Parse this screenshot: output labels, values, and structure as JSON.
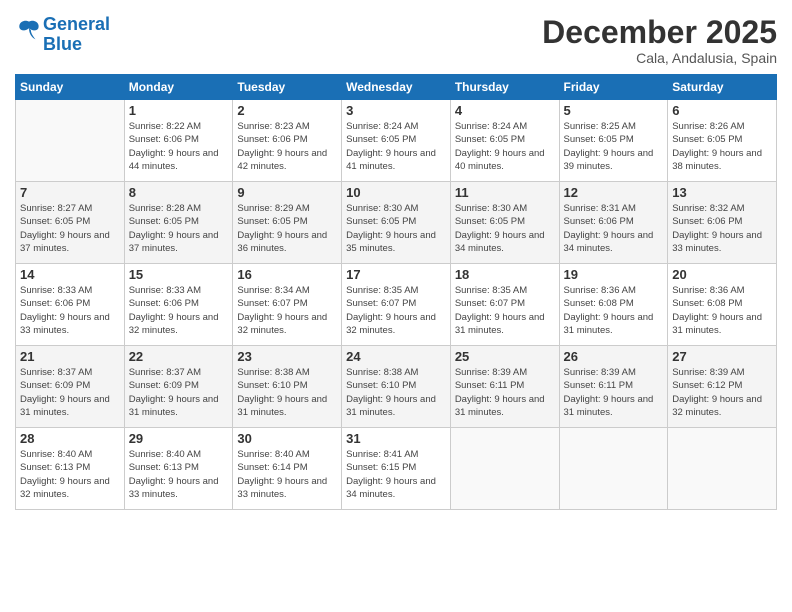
{
  "header": {
    "logo_line1": "General",
    "logo_line2": "Blue",
    "month": "December 2025",
    "location": "Cala, Andalusia, Spain"
  },
  "weekdays": [
    "Sunday",
    "Monday",
    "Tuesday",
    "Wednesday",
    "Thursday",
    "Friday",
    "Saturday"
  ],
  "weeks": [
    [
      {
        "day": "",
        "sunrise": "",
        "sunset": "",
        "daylight": ""
      },
      {
        "day": "1",
        "sunrise": "Sunrise: 8:22 AM",
        "sunset": "Sunset: 6:06 PM",
        "daylight": "Daylight: 9 hours and 44 minutes."
      },
      {
        "day": "2",
        "sunrise": "Sunrise: 8:23 AM",
        "sunset": "Sunset: 6:06 PM",
        "daylight": "Daylight: 9 hours and 42 minutes."
      },
      {
        "day": "3",
        "sunrise": "Sunrise: 8:24 AM",
        "sunset": "Sunset: 6:05 PM",
        "daylight": "Daylight: 9 hours and 41 minutes."
      },
      {
        "day": "4",
        "sunrise": "Sunrise: 8:24 AM",
        "sunset": "Sunset: 6:05 PM",
        "daylight": "Daylight: 9 hours and 40 minutes."
      },
      {
        "day": "5",
        "sunrise": "Sunrise: 8:25 AM",
        "sunset": "Sunset: 6:05 PM",
        "daylight": "Daylight: 9 hours and 39 minutes."
      },
      {
        "day": "6",
        "sunrise": "Sunrise: 8:26 AM",
        "sunset": "Sunset: 6:05 PM",
        "daylight": "Daylight: 9 hours and 38 minutes."
      }
    ],
    [
      {
        "day": "7",
        "sunrise": "Sunrise: 8:27 AM",
        "sunset": "Sunset: 6:05 PM",
        "daylight": "Daylight: 9 hours and 37 minutes."
      },
      {
        "day": "8",
        "sunrise": "Sunrise: 8:28 AM",
        "sunset": "Sunset: 6:05 PM",
        "daylight": "Daylight: 9 hours and 37 minutes."
      },
      {
        "day": "9",
        "sunrise": "Sunrise: 8:29 AM",
        "sunset": "Sunset: 6:05 PM",
        "daylight": "Daylight: 9 hours and 36 minutes."
      },
      {
        "day": "10",
        "sunrise": "Sunrise: 8:30 AM",
        "sunset": "Sunset: 6:05 PM",
        "daylight": "Daylight: 9 hours and 35 minutes."
      },
      {
        "day": "11",
        "sunrise": "Sunrise: 8:30 AM",
        "sunset": "Sunset: 6:05 PM",
        "daylight": "Daylight: 9 hours and 34 minutes."
      },
      {
        "day": "12",
        "sunrise": "Sunrise: 8:31 AM",
        "sunset": "Sunset: 6:06 PM",
        "daylight": "Daylight: 9 hours and 34 minutes."
      },
      {
        "day": "13",
        "sunrise": "Sunrise: 8:32 AM",
        "sunset": "Sunset: 6:06 PM",
        "daylight": "Daylight: 9 hours and 33 minutes."
      }
    ],
    [
      {
        "day": "14",
        "sunrise": "Sunrise: 8:33 AM",
        "sunset": "Sunset: 6:06 PM",
        "daylight": "Daylight: 9 hours and 33 minutes."
      },
      {
        "day": "15",
        "sunrise": "Sunrise: 8:33 AM",
        "sunset": "Sunset: 6:06 PM",
        "daylight": "Daylight: 9 hours and 32 minutes."
      },
      {
        "day": "16",
        "sunrise": "Sunrise: 8:34 AM",
        "sunset": "Sunset: 6:07 PM",
        "daylight": "Daylight: 9 hours and 32 minutes."
      },
      {
        "day": "17",
        "sunrise": "Sunrise: 8:35 AM",
        "sunset": "Sunset: 6:07 PM",
        "daylight": "Daylight: 9 hours and 32 minutes."
      },
      {
        "day": "18",
        "sunrise": "Sunrise: 8:35 AM",
        "sunset": "Sunset: 6:07 PM",
        "daylight": "Daylight: 9 hours and 31 minutes."
      },
      {
        "day": "19",
        "sunrise": "Sunrise: 8:36 AM",
        "sunset": "Sunset: 6:08 PM",
        "daylight": "Daylight: 9 hours and 31 minutes."
      },
      {
        "day": "20",
        "sunrise": "Sunrise: 8:36 AM",
        "sunset": "Sunset: 6:08 PM",
        "daylight": "Daylight: 9 hours and 31 minutes."
      }
    ],
    [
      {
        "day": "21",
        "sunrise": "Sunrise: 8:37 AM",
        "sunset": "Sunset: 6:09 PM",
        "daylight": "Daylight: 9 hours and 31 minutes."
      },
      {
        "day": "22",
        "sunrise": "Sunrise: 8:37 AM",
        "sunset": "Sunset: 6:09 PM",
        "daylight": "Daylight: 9 hours and 31 minutes."
      },
      {
        "day": "23",
        "sunrise": "Sunrise: 8:38 AM",
        "sunset": "Sunset: 6:10 PM",
        "daylight": "Daylight: 9 hours and 31 minutes."
      },
      {
        "day": "24",
        "sunrise": "Sunrise: 8:38 AM",
        "sunset": "Sunset: 6:10 PM",
        "daylight": "Daylight: 9 hours and 31 minutes."
      },
      {
        "day": "25",
        "sunrise": "Sunrise: 8:39 AM",
        "sunset": "Sunset: 6:11 PM",
        "daylight": "Daylight: 9 hours and 31 minutes."
      },
      {
        "day": "26",
        "sunrise": "Sunrise: 8:39 AM",
        "sunset": "Sunset: 6:11 PM",
        "daylight": "Daylight: 9 hours and 31 minutes."
      },
      {
        "day": "27",
        "sunrise": "Sunrise: 8:39 AM",
        "sunset": "Sunset: 6:12 PM",
        "daylight": "Daylight: 9 hours and 32 minutes."
      }
    ],
    [
      {
        "day": "28",
        "sunrise": "Sunrise: 8:40 AM",
        "sunset": "Sunset: 6:13 PM",
        "daylight": "Daylight: 9 hours and 32 minutes."
      },
      {
        "day": "29",
        "sunrise": "Sunrise: 8:40 AM",
        "sunset": "Sunset: 6:13 PM",
        "daylight": "Daylight: 9 hours and 33 minutes."
      },
      {
        "day": "30",
        "sunrise": "Sunrise: 8:40 AM",
        "sunset": "Sunset: 6:14 PM",
        "daylight": "Daylight: 9 hours and 33 minutes."
      },
      {
        "day": "31",
        "sunrise": "Sunrise: 8:41 AM",
        "sunset": "Sunset: 6:15 PM",
        "daylight": "Daylight: 9 hours and 34 minutes."
      },
      {
        "day": "",
        "sunrise": "",
        "sunset": "",
        "daylight": ""
      },
      {
        "day": "",
        "sunrise": "",
        "sunset": "",
        "daylight": ""
      },
      {
        "day": "",
        "sunrise": "",
        "sunset": "",
        "daylight": ""
      }
    ]
  ]
}
